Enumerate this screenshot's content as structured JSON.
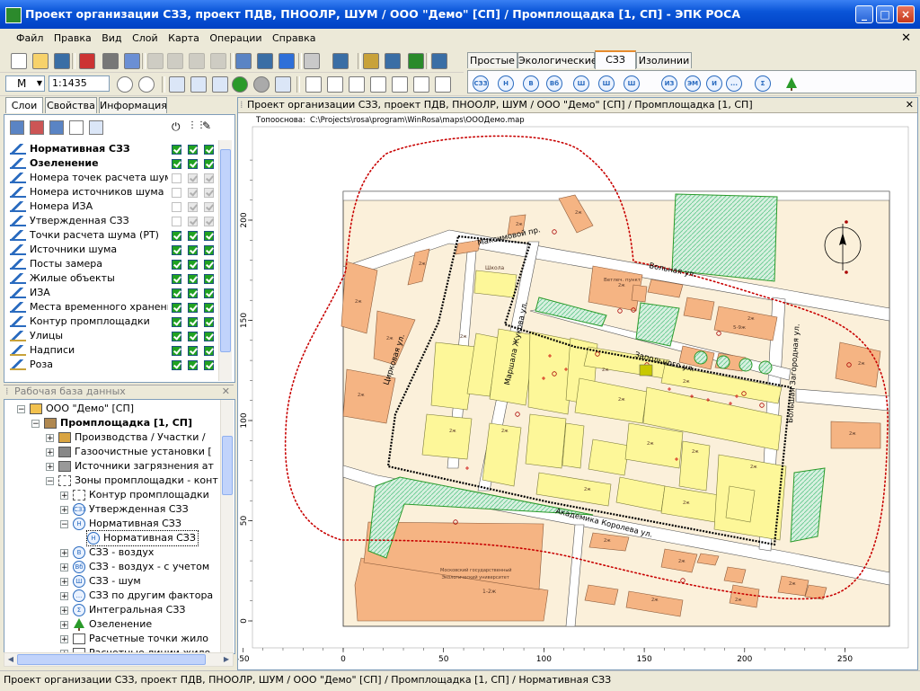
{
  "window": {
    "title": "Проект организации СЗЗ, проект ПДВ, ПНООЛР, ШУМ / ООО \"Демо\"  [СП] / Промплощадка  [1, СП]  -  ЭПК РОСА"
  },
  "menu": [
    "Файл",
    "Правка",
    "Вид",
    "Слой",
    "Карта",
    "Операции",
    "Справка"
  ],
  "toolbar": {
    "mode_label": "M",
    "scale_value": "1:1435"
  },
  "ribbon_tabs": [
    {
      "label": "Простые",
      "active": false
    },
    {
      "label": "Экологические",
      "active": false
    },
    {
      "label": "СЗЗ",
      "active": true
    },
    {
      "label": "Изолинии",
      "active": false
    }
  ],
  "szz_buttons": [
    "СЗЗ",
    "Н",
    "В",
    "Вб",
    "Ш",
    "Ш",
    "Ш",
    "ИЗ",
    "ЭМ",
    "И",
    "...",
    "Σ",
    "tree"
  ],
  "layers_panel": {
    "tabs": [
      {
        "label": "Слои",
        "active": true
      },
      {
        "label": "Свойства",
        "active": false
      },
      {
        "label": "Информация",
        "active": false
      }
    ],
    "layers": [
      {
        "name": "Нормативная СЗЗ",
        "bold": true,
        "c1": true,
        "c2": true,
        "c3": true,
        "dis": false
      },
      {
        "name": "Озеленение",
        "bold": true,
        "c1": true,
        "c2": true,
        "c3": true,
        "dis": false
      },
      {
        "name": "Номера точек расчета шума",
        "bold": false,
        "c1": false,
        "c2": true,
        "c3": true,
        "dis": true
      },
      {
        "name": "Номера источников шума",
        "bold": false,
        "c1": false,
        "c2": true,
        "c3": true,
        "dis": true
      },
      {
        "name": "Номера ИЗА",
        "bold": false,
        "c1": false,
        "c2": true,
        "c3": true,
        "dis": true
      },
      {
        "name": "Утвержденная СЗЗ",
        "bold": false,
        "c1": false,
        "c2": true,
        "c3": true,
        "dis": true
      },
      {
        "name": "Точки расчета шума (РТ)",
        "bold": false,
        "c1": true,
        "c2": true,
        "c3": true,
        "dis": false
      },
      {
        "name": "Источники шума",
        "bold": false,
        "c1": true,
        "c2": true,
        "c3": true,
        "dis": false
      },
      {
        "name": "Посты замера",
        "bold": false,
        "c1": true,
        "c2": true,
        "c3": true,
        "dis": false
      },
      {
        "name": "Жилые объекты",
        "bold": false,
        "c1": true,
        "c2": true,
        "c3": true,
        "dis": false
      },
      {
        "name": "ИЗА",
        "bold": false,
        "c1": true,
        "c2": true,
        "c3": true,
        "dis": false
      },
      {
        "name": "Места временного хранения о",
        "bold": false,
        "c1": true,
        "c2": true,
        "c3": true,
        "dis": false
      },
      {
        "name": "Контур промплощадки",
        "bold": false,
        "c1": true,
        "c2": true,
        "c3": true,
        "dis": false
      },
      {
        "name": "Улицы",
        "bold": false,
        "c1": true,
        "c2": true,
        "c3": true,
        "dis": false
      },
      {
        "name": "Надписи",
        "bold": false,
        "c1": true,
        "c2": true,
        "c3": true,
        "dis": false
      },
      {
        "name": "Роза",
        "bold": false,
        "c1": true,
        "c2": true,
        "c3": true,
        "dis": false
      }
    ]
  },
  "db_panel": {
    "title": "Рабочая база данных",
    "items": [
      {
        "label": "ООО \"Демо\"  [СП]",
        "level": 0,
        "bold": false,
        "exp": "-",
        "icon": "folder"
      },
      {
        "label": "Промплощадка  [1, СП]",
        "level": 1,
        "bold": true,
        "exp": "-",
        "icon": "factory"
      },
      {
        "label": "Производства / Участки / ",
        "level": 2,
        "bold": false,
        "exp": "+",
        "icon": "box"
      },
      {
        "label": "Газоочистные установки [",
        "level": 2,
        "bold": false,
        "exp": "+",
        "icon": "gas"
      },
      {
        "label": "Источники загрязнения ат",
        "level": 2,
        "bold": false,
        "exp": "+",
        "icon": "src"
      },
      {
        "label": "Зоны промплощадки - конт",
        "level": 2,
        "bold": false,
        "exp": "-",
        "icon": "zone"
      },
      {
        "label": "Контур промплощадки",
        "level": 3,
        "bold": false,
        "exp": "+",
        "icon": "contour"
      },
      {
        "label": "Утвержденная СЗЗ",
        "level": 3,
        "bold": false,
        "exp": "+",
        "icon": "СЗЗ"
      },
      {
        "label": "Нормативная СЗЗ",
        "level": 3,
        "bold": false,
        "exp": "-",
        "icon": "Н"
      },
      {
        "label": "Нормативная СЗЗ",
        "level": 4,
        "bold": false,
        "exp": "",
        "icon": "Н",
        "selected": true
      },
      {
        "label": "СЗЗ - воздух",
        "level": 3,
        "bold": false,
        "exp": "+",
        "icon": "В"
      },
      {
        "label": "СЗЗ - воздух - с учетом",
        "level": 3,
        "bold": false,
        "exp": "+",
        "icon": "Вб"
      },
      {
        "label": "СЗЗ - шум",
        "level": 3,
        "bold": false,
        "exp": "+",
        "icon": "Ш"
      },
      {
        "label": "СЗЗ по другим фактора",
        "level": 3,
        "bold": false,
        "exp": "+",
        "icon": "..."
      },
      {
        "label": "Интегральная СЗЗ",
        "level": 3,
        "bold": false,
        "exp": "+",
        "icon": "Σ"
      },
      {
        "label": "Озеленение",
        "level": 3,
        "bold": false,
        "exp": "+",
        "icon": "tree"
      },
      {
        "label": "Расчетные точки жило",
        "level": 3,
        "bold": false,
        "exp": "+",
        "icon": "pt"
      },
      {
        "label": "Расчетные линии жило",
        "level": 3,
        "bold": false,
        "exp": "+",
        "icon": "ln"
      }
    ]
  },
  "map": {
    "header": "Проект организации СЗЗ, проект ПДВ, ПНООЛР, ШУМ / ООО \"Демо\"  [СП] / Промплощадка  [1, СП]",
    "toposnova_label": "Топооснова:",
    "toposnova_path": "C:\\Projects\\rosa\\program\\WinRosa\\maps\\ОООДемо.map",
    "x_ticks": [
      "-50",
      "0",
      "50",
      "100",
      "150",
      "200",
      "250"
    ],
    "y_ticks": [
      "200",
      "150",
      "100",
      "50",
      "0"
    ],
    "streets": [
      "Максимовой пр.",
      "Вольная ул.",
      "Запольного ул.",
      "Маршала Жукова ул.",
      "Цирковая ул.",
      "Академика Королева ул.",
      "Большая Загородная ул."
    ],
    "building_labels": {
      "school": "Школа",
      "vet": "Ветлеч. пункт",
      "university": "Московский государственный Экологический университет",
      "floors": "2ж",
      "floors_big": "1-2ж",
      "floors5": "5-9ж"
    },
    "colors": {
      "building": "#f5b483",
      "industrial": "#fdf799",
      "ground": "#fbf0da",
      "street": "#ffffff",
      "green": "#5ec88a",
      "szz": "#c80000"
    }
  },
  "statusbar": {
    "text": "Проект организации СЗЗ, проект ПДВ, ПНООЛР, ШУМ / ООО \"Демо\"  [СП] / Промплощадка  [1, СП] / Нормативная СЗЗ"
  }
}
